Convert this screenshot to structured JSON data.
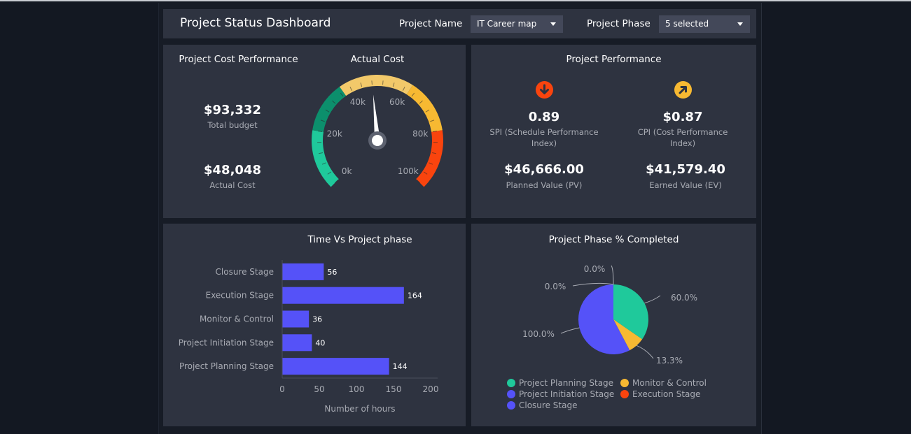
{
  "header": {
    "title": "Project Status Dashboard",
    "filters": [
      {
        "label": "Project Name",
        "value": "IT Career map"
      },
      {
        "label": "Project Phase",
        "value": "5 selected"
      }
    ]
  },
  "cost_panel": {
    "title": "Project Cost Performance",
    "total_budget": {
      "value": "$93,332",
      "label": "Total budget"
    },
    "actual_cost": {
      "value": "$48,048",
      "label": "Actual Cost"
    }
  },
  "gauge": {
    "title": "Actual Cost",
    "min": 0,
    "max": 100000,
    "value": 48048,
    "tick_labels": [
      "0k",
      "20k",
      "40k",
      "60k",
      "80k",
      "100k"
    ],
    "bands": [
      {
        "from": 0,
        "to": 20000,
        "color": "#1fc99b"
      },
      {
        "from": 20000,
        "to": 37000,
        "color": "#0c8f6c"
      },
      {
        "from": 37000,
        "to": 62000,
        "color": "#f2c96a"
      },
      {
        "from": 62000,
        "to": 80000,
        "color": "#f7b932"
      },
      {
        "from": 80000,
        "to": 100000,
        "color": "#f9440e"
      }
    ]
  },
  "performance": {
    "title": "Project Performance",
    "spi": {
      "value": "0.89",
      "label_line1": "SPI (Schedule Performance",
      "label_line2": "Index)",
      "icon": "arrow-down-icon",
      "icon_color": "#f9440e"
    },
    "cpi": {
      "value": "$0.87",
      "label_line1": "CPI (Cost Performance",
      "label_line2": "Index)",
      "icon": "arrow-up-right-icon",
      "icon_color": "#f7b932"
    },
    "pv": {
      "value": "$46,666.00",
      "label": "Planned Value (PV)"
    },
    "ev": {
      "value": "$41,579.40",
      "label": "Earned Value (EV)"
    }
  },
  "chart_data": [
    {
      "type": "bar",
      "orientation": "horizontal",
      "title": "Time Vs Project phase",
      "categories": [
        "Closure Stage",
        "Execution Stage",
        "Monitor & Control",
        "Project Initiation Stage",
        "Project Planning Stage"
      ],
      "values": [
        56,
        164,
        36,
        40,
        144
      ],
      "value_labels": [
        "56",
        "164",
        "36",
        "40",
        "144"
      ],
      "xlabel": "Number of hours",
      "ylabel": "",
      "xlim": [
        0,
        200
      ],
      "xticks": [
        "0",
        "50",
        "100",
        "150",
        "200"
      ],
      "bar_color": "#5552f8",
      "grid": false
    },
    {
      "type": "pie",
      "title": "Project Phase % Completed",
      "categories": [
        "Project Planning Stage",
        "Monitor & Control",
        "Project Initiation Stage",
        "Execution Stage",
        "Closure Stage"
      ],
      "values": [
        60.0,
        13.3,
        100.0,
        0.0,
        0.0
      ],
      "data_labels": [
        "60.0%",
        "13.3%",
        "100.0%",
        "0.0%",
        "0.0%"
      ],
      "colors": [
        "#1fc99b",
        "#f7b932",
        "#5552f8",
        "#f9440e",
        "#5552f8"
      ],
      "legend": [
        {
          "label": "Project Planning Stage",
          "color": "#1fc99b"
        },
        {
          "label": "Monitor & Control",
          "color": "#f7b932"
        },
        {
          "label": "Project Initiation Stage",
          "color": "#5552f8"
        },
        {
          "label": "Execution Stage",
          "color": "#f9440e"
        },
        {
          "label": "Closure Stage",
          "color": "#5552f8"
        }
      ],
      "legend_position": "bottom"
    }
  ]
}
